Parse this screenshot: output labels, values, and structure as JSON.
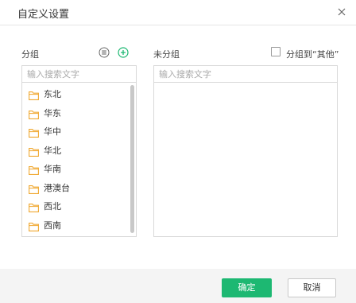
{
  "dialog": {
    "title": "自定义设置",
    "close_icon": "close-icon"
  },
  "left": {
    "label": "分组",
    "menu_icon": "list-menu-icon",
    "add_icon": "plus-circle-icon",
    "search_placeholder": "输入搜索文字",
    "items": [
      {
        "label": "东北"
      },
      {
        "label": "华东"
      },
      {
        "label": "华中"
      },
      {
        "label": "华北"
      },
      {
        "label": "华南"
      },
      {
        "label": "港澳台"
      },
      {
        "label": "西北"
      },
      {
        "label": "西南"
      }
    ]
  },
  "right": {
    "label": "未分组",
    "checkbox_label": "分组到“其他”",
    "checkbox_checked": false,
    "search_placeholder": "输入搜索文字"
  },
  "footer": {
    "ok_label": "确定",
    "cancel_label": "取消"
  },
  "colors": {
    "accent": "#1db872",
    "folder": "#f0a830"
  }
}
